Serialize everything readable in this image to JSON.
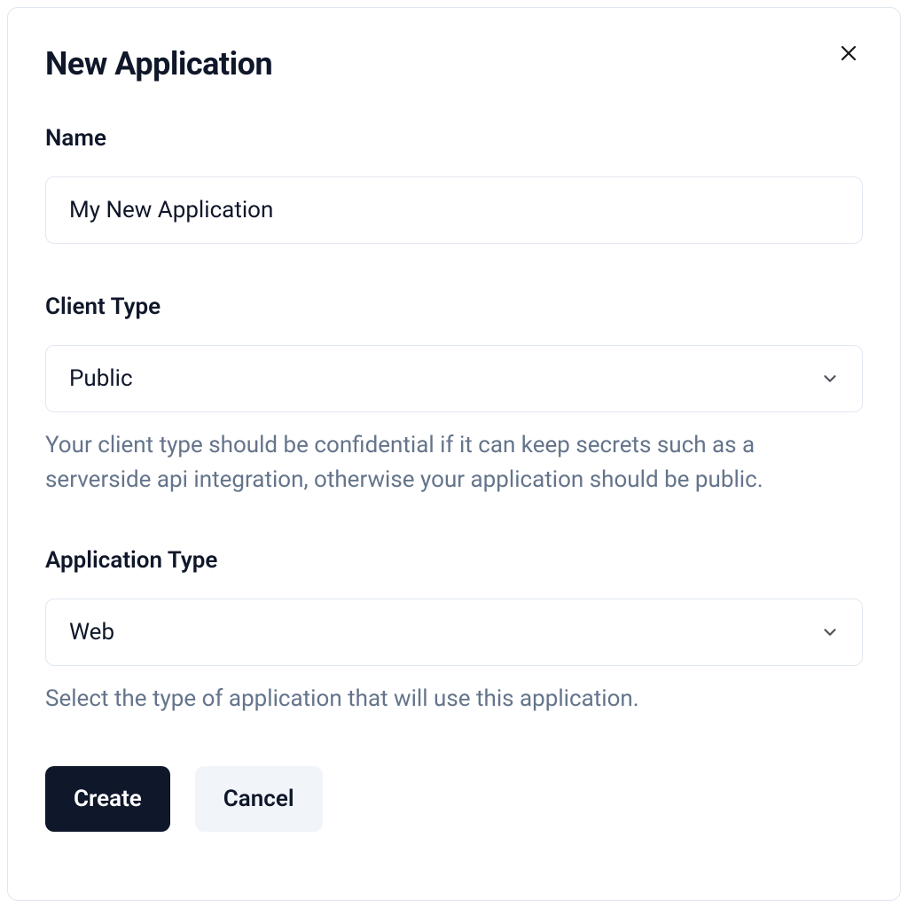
{
  "modal": {
    "title": "New Application",
    "close_aria": "Close"
  },
  "form": {
    "name": {
      "label": "Name",
      "value": "My New Application"
    },
    "client_type": {
      "label": "Client Type",
      "value": "Public",
      "help_text": "Your client type should be confidential if it can keep secrets such as a serverside api integration, otherwise your application should be public."
    },
    "application_type": {
      "label": "Application Type",
      "value": "Web",
      "help_text": "Select the type of application that will use this application."
    }
  },
  "buttons": {
    "create": "Create",
    "cancel": "Cancel"
  }
}
